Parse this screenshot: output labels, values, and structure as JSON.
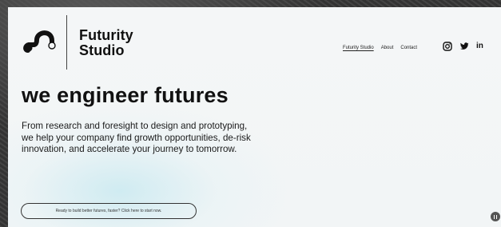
{
  "brand": {
    "name_line1": "Futurity",
    "name_line2": "Studio",
    "logo_icon": "futurity-logo-mark"
  },
  "nav": {
    "items": [
      {
        "label": "Futurity Studio",
        "active": true
      },
      {
        "label": "About",
        "active": false
      },
      {
        "label": "Contact",
        "active": false
      }
    ],
    "social": [
      "instagram-icon",
      "twitter-icon",
      "linkedin-icon"
    ],
    "linkedin_label": "in"
  },
  "hero": {
    "headline": "we engineer futures",
    "intro": "From research and foresight to design and prototyping, we help your company find growth opportunities, de-risk innovation, and accelerate your journey to tomorrow.",
    "cta_label": "Ready to build better futures, faster? Click here to start now."
  },
  "controls": {
    "pause_icon": "pause-icon"
  },
  "colors": {
    "text": "#111111",
    "background": "#f4f6f7",
    "accent_glow": "#c4e8f0"
  }
}
